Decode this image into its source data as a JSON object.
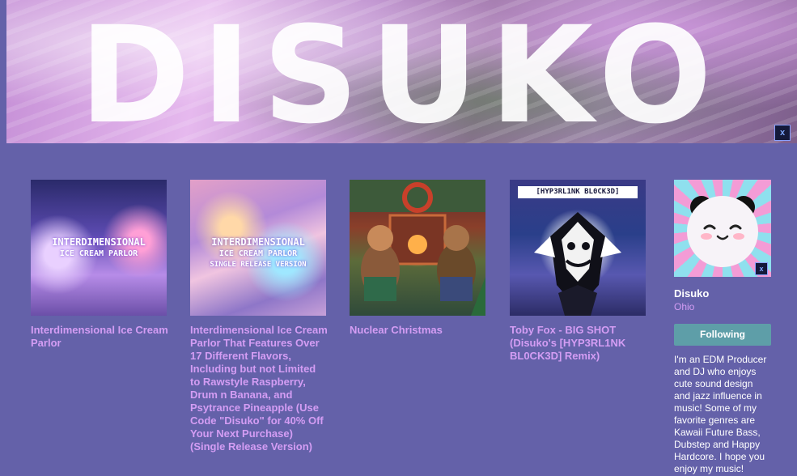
{
  "banner": {
    "logo_text": "DISUKO",
    "close_label": "x"
  },
  "albums": [
    {
      "title": "Interdimensional Ice Cream Parlor",
      "cover_lines": [
        "INTERDIMENSIONAL",
        "ICE CREAM PARLOR"
      ]
    },
    {
      "title": "Interdimensional Ice Cream Parlor That Features Over 17 Different Flavors, Including but not Limited to Rawstyle Raspberry, Drum n Banana, and Psytrance Pineapple (Use Code \"Disuko\" for 40% Off Your Next Purchase) (Single Release Version)",
      "cover_lines": [
        "INTERDIMENSIONAL",
        "ICE CREAM PARLOR",
        "SINGLE RELEASE VERSION"
      ]
    },
    {
      "title": "Nuclear Christmas"
    },
    {
      "title": "Toby Fox - BIG SHOT (Disuko's [HYP3RL1NK BL0CK3D] Remix)",
      "cover_lines": [
        "[HYP3RL1NK BL0CK3D]"
      ]
    }
  ],
  "artist": {
    "name": "Disuko",
    "location": "Ohio",
    "follow_label": "Following",
    "bio": "I'm an EDM Producer and DJ who enjoys cute sound design and jazz influence in music! Some of my favorite genres are Kawaii Future Bass, Dubstep and Happy Hardcore. I hope you enjoy my music!",
    "avatar_close_label": "x"
  },
  "colors": {
    "page_background": "#6461a9",
    "link": "#d49df4",
    "follow_button": "#5e9ea8"
  },
  "icons": {
    "banner_close": "close-icon",
    "avatar_close": "close-icon"
  }
}
